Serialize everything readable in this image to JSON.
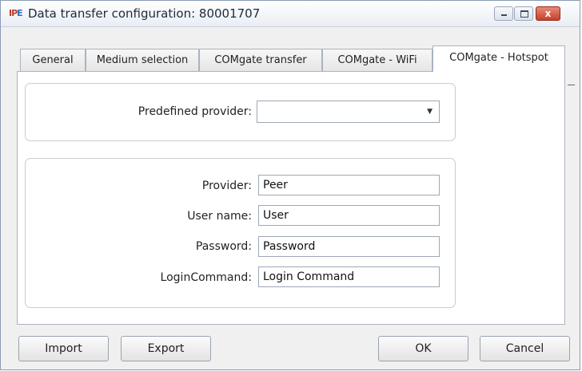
{
  "window": {
    "title": "Data transfer configuration: 80001707",
    "app_icon_text": "IP",
    "app_icon_text2": "E",
    "close_glyph": "x"
  },
  "tabs": [
    {
      "label": "General"
    },
    {
      "label": "Medium selection"
    },
    {
      "label": "COMgate transfer"
    },
    {
      "label": "COMgate - WiFi"
    },
    {
      "label": "COMgate - Hotspot",
      "active": true
    }
  ],
  "predefined": {
    "label": "Predefined provider:",
    "value": "",
    "caret": "▼"
  },
  "fields": {
    "provider": {
      "label": "Provider:",
      "value": "Peer"
    },
    "username": {
      "label": "User name:",
      "value": "User"
    },
    "password": {
      "label": "Password:",
      "value": "Password"
    },
    "login_command": {
      "label": "LoginCommand:",
      "value": "Login Command"
    }
  },
  "buttons": {
    "import": "Import",
    "export": "Export",
    "ok": "OK",
    "cancel": "Cancel"
  },
  "colors": {
    "close_button": "#c6402a",
    "border": "#a9b3c2"
  }
}
